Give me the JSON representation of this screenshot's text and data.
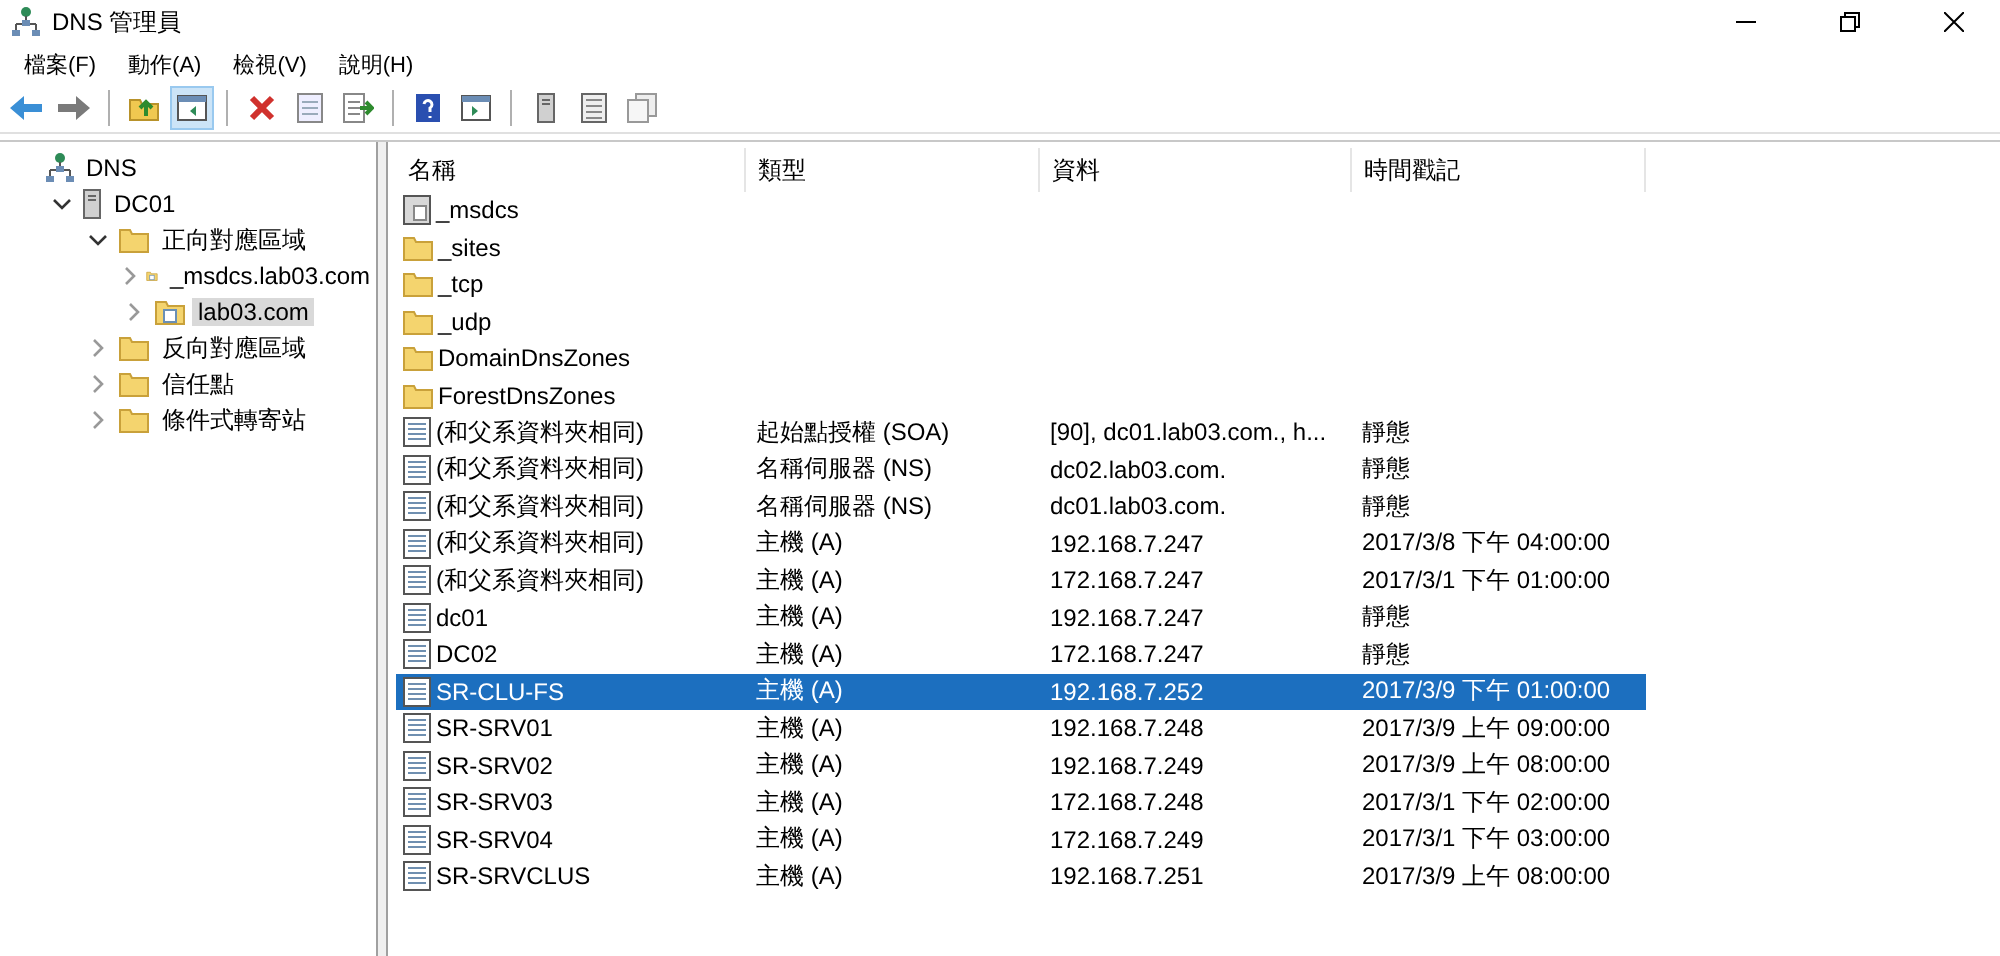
{
  "window": {
    "title": "DNS 管理員"
  },
  "menu": [
    "檔案(F)",
    "動作(A)",
    "檢視(V)",
    "說明(H)"
  ],
  "toolbar": [
    {
      "kind": "back",
      "pressed": false
    },
    {
      "kind": "forward",
      "pressed": false
    },
    {
      "kind": "separator"
    },
    {
      "kind": "up",
      "pressed": false
    },
    {
      "kind": "tree-toggle",
      "pressed": true
    },
    {
      "kind": "separator"
    },
    {
      "kind": "delete",
      "pressed": false
    },
    {
      "kind": "properties",
      "pressed": false
    },
    {
      "kind": "export",
      "pressed": false
    },
    {
      "kind": "separator"
    },
    {
      "kind": "help",
      "pressed": false
    },
    {
      "kind": "pane",
      "pressed": false
    },
    {
      "kind": "separator"
    },
    {
      "kind": "server",
      "pressed": false
    },
    {
      "kind": "list",
      "pressed": false
    },
    {
      "kind": "copy",
      "pressed": false
    }
  ],
  "tree": [
    {
      "label": "DNS",
      "kind": "dns",
      "selected": false,
      "children": [
        {
          "label": "DC01",
          "kind": "server",
          "expanded": true,
          "selected": false,
          "children": [
            {
              "label": "正向對應區域",
              "kind": "folder",
              "expanded": true,
              "selected": false,
              "children": [
                {
                  "label": "_msdcs.lab03.com",
                  "kind": "zone",
                  "expanded": false,
                  "selected": false
                },
                {
                  "label": "lab03.com",
                  "kind": "zone",
                  "expanded": false,
                  "selected": true
                }
              ]
            },
            {
              "label": "反向對應區域",
              "kind": "folder",
              "expanded": false,
              "selected": false
            },
            {
              "label": "信任點",
              "kind": "folder",
              "expanded": false,
              "selected": false
            },
            {
              "label": "條件式轉寄站",
              "kind": "folder",
              "expanded": false,
              "selected": false
            }
          ]
        }
      ]
    }
  ],
  "table": {
    "columns": [
      "名稱",
      "類型",
      "資料",
      "時間戳記"
    ],
    "rows": [
      {
        "kind": "delegation",
        "name": "_msdcs",
        "selected": false
      },
      {
        "kind": "folder",
        "name": "_sites",
        "selected": false
      },
      {
        "kind": "folder",
        "name": "_tcp",
        "selected": false
      },
      {
        "kind": "folder",
        "name": "_udp",
        "selected": false
      },
      {
        "kind": "folder",
        "name": "DomainDnsZones",
        "selected": false
      },
      {
        "kind": "folder",
        "name": "ForestDnsZones",
        "selected": false
      },
      {
        "kind": "record",
        "name": "(和父系資料夾相同)",
        "type": "起始點授權 (SOA)",
        "data": "[90], dc01.lab03.com., h...",
        "timestamp": "靜態",
        "selected": false
      },
      {
        "kind": "record",
        "name": "(和父系資料夾相同)",
        "type": "名稱伺服器 (NS)",
        "data": "dc02.lab03.com.",
        "timestamp": "靜態",
        "selected": false
      },
      {
        "kind": "record",
        "name": "(和父系資料夾相同)",
        "type": "名稱伺服器 (NS)",
        "data": "dc01.lab03.com.",
        "timestamp": "靜態",
        "selected": false
      },
      {
        "kind": "record",
        "name": "(和父系資料夾相同)",
        "type": "主機 (A)",
        "data": "192.168.7.247",
        "timestamp": "2017/3/8 下午 04:00:00",
        "selected": false
      },
      {
        "kind": "record",
        "name": "(和父系資料夾相同)",
        "type": "主機 (A)",
        "data": "172.168.7.247",
        "timestamp": "2017/3/1 下午 01:00:00",
        "selected": false
      },
      {
        "kind": "record",
        "name": "dc01",
        "type": "主機 (A)",
        "data": "192.168.7.247",
        "timestamp": "靜態",
        "selected": false
      },
      {
        "kind": "record",
        "name": "DC02",
        "type": "主機 (A)",
        "data": "172.168.7.247",
        "timestamp": "靜態",
        "selected": false
      },
      {
        "kind": "record",
        "name": "SR-CLU-FS",
        "type": "主機 (A)",
        "data": "192.168.7.252",
        "timestamp": "2017/3/9 下午 01:00:00",
        "selected": true
      },
      {
        "kind": "record",
        "name": "SR-SRV01",
        "type": "主機 (A)",
        "data": "192.168.7.248",
        "timestamp": "2017/3/9 上午 09:00:00",
        "selected": false
      },
      {
        "kind": "record",
        "name": "SR-SRV02",
        "type": "主機 (A)",
        "data": "192.168.7.249",
        "timestamp": "2017/3/9 上午 08:00:00",
        "selected": false
      },
      {
        "kind": "record",
        "name": "SR-SRV03",
        "type": "主機 (A)",
        "data": "172.168.7.248",
        "timestamp": "2017/3/1 下午 02:00:00",
        "selected": false
      },
      {
        "kind": "record",
        "name": "SR-SRV04",
        "type": "主機 (A)",
        "data": "172.168.7.249",
        "timestamp": "2017/3/1 下午 03:00:00",
        "selected": false
      },
      {
        "kind": "record",
        "name": "SR-SRVCLUS",
        "type": "主機 (A)",
        "data": "192.168.7.251",
        "timestamp": "2017/3/9 上午 08:00:00",
        "selected": false
      }
    ]
  }
}
